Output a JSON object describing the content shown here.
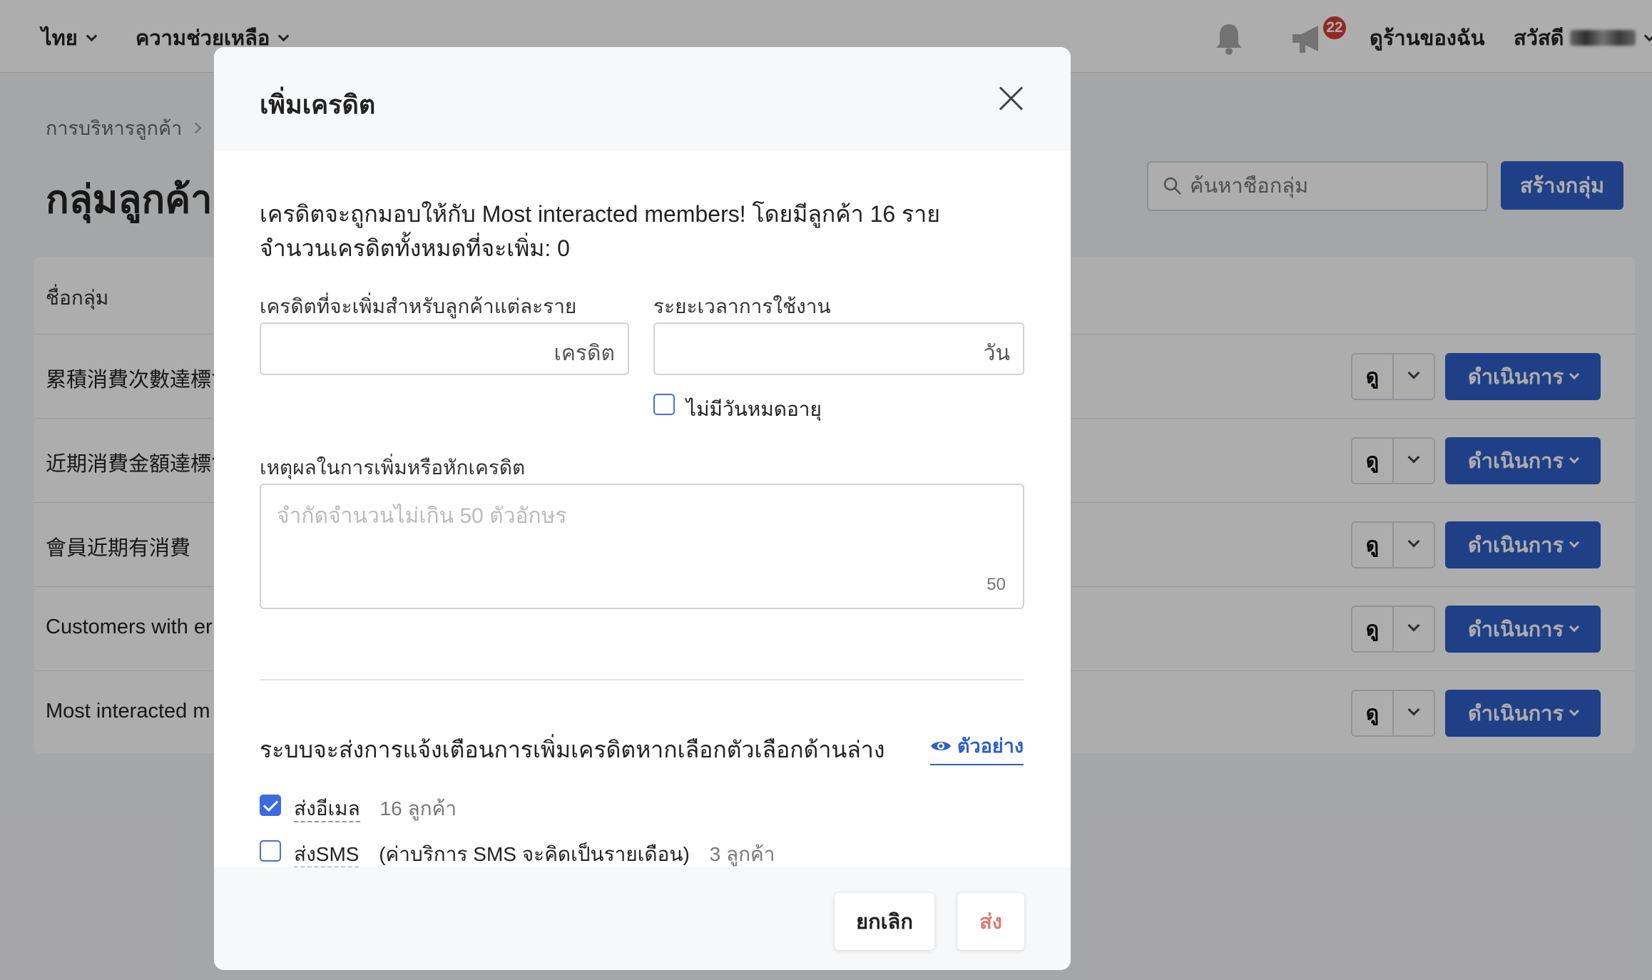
{
  "topbar": {
    "language": "ไทย",
    "help": "ความช่วยเหลือ",
    "notification_count": "22",
    "my_store": "ดูร้านของฉัน",
    "greeting": "สวัสดี"
  },
  "breadcrumb": {
    "parent": "การบริหารลูกค้า"
  },
  "page": {
    "title": "กลุ่มลูกค้า",
    "search_placeholder": "ค้นหาชื่อกลุ่ม",
    "create_button": "สร้างกลุ่ม"
  },
  "table": {
    "header_name": "ชื่อกลุ่ม",
    "view_label": "ดู",
    "action_label": "ดำเนินการ",
    "rows": [
      {
        "name": "累積消費次數達標會"
      },
      {
        "name": "近期消費金額達標會"
      },
      {
        "name": "會員近期有消費"
      },
      {
        "name": "Customers with er"
      },
      {
        "name": "Most interacted m"
      }
    ]
  },
  "modal": {
    "title": "เพิ่มเครดิต",
    "info_line1": "เครดิตจะถูกมอบให้กับ Most interacted members! โดยมีลูกค้า 16 ราย",
    "info_line2": "จำนวนเครดิตทั้งหมดที่จะเพิ่ม: 0",
    "credit_label": "เครดิตที่จะเพิ่มสำหรับลูกค้าแต่ละราย",
    "credit_unit": "เครดิต",
    "duration_label": "ระยะเวลาการใช้งาน",
    "duration_unit": "วัน",
    "no_expiry": "ไม่มีวันหมดอายุ",
    "reason_label": "เหตุผลในการเพิ่มหรือหักเครดิต",
    "reason_placeholder": "จำกัดจำนวนไม่เกิน 50 ตัวอักษร",
    "reason_counter": "50",
    "notify_label": "ระบบจะส่งการแจ้งเตือนการเพิ่มเครดิตหากเลือกตัวเลือกด้านล่าง",
    "preview": "ตัวอย่าง",
    "email_label": "ส่งอีเมล",
    "email_count": "16 ลูกค้า",
    "sms_label": "ส่งSMS",
    "sms_note": "(ค่าบริการ SMS จะคิดเป็นรายเดือน)",
    "sms_count": "3 ลูกค้า",
    "cancel": "ยกเลิก",
    "send": "ส่ง"
  },
  "colors": {
    "primary": "#2f5fc8",
    "send_text": "#e07a6e",
    "badge": "#d83a3a"
  },
  "icons": [
    "bell-icon",
    "megaphone-icon",
    "search-icon",
    "close-icon",
    "eye-icon",
    "chevron-down-icon"
  ]
}
